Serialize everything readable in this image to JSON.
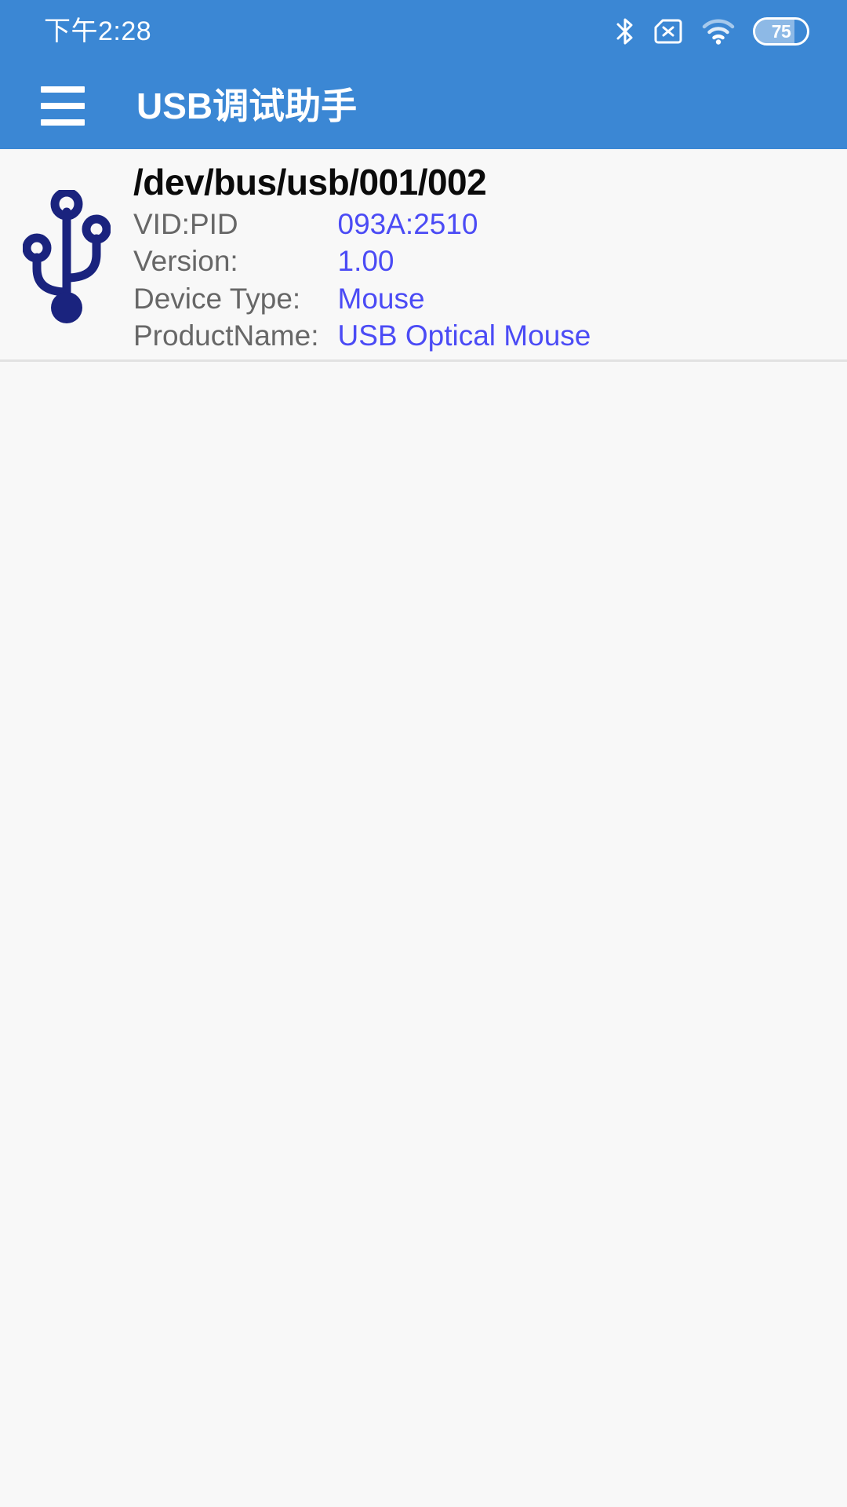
{
  "status_bar": {
    "time": "下午2:28",
    "icons": [
      {
        "name": "bluetooth-icon",
        "label": "Bluetooth"
      },
      {
        "name": "no-sim-icon",
        "label": "No SIM"
      },
      {
        "name": "wifi-icon",
        "label": "Wi-Fi"
      }
    ],
    "battery": {
      "level_text": "75",
      "level_percent": 75
    }
  },
  "app_bar": {
    "menu_icon": "hamburger-menu-icon",
    "title": "USB调试助手",
    "background_color": "#3b87d4",
    "title_color": "#ffffff"
  },
  "colors": {
    "accent": "#3b87d4",
    "page_background": "#f8f8f8",
    "key_text": "#676767",
    "value_text": "#4b4bf5",
    "path_text": "#0b0b0b",
    "usb_icon": "#1a237e",
    "divider": "#e2e2e2"
  },
  "device_list": [
    {
      "icon": "usb-trident-icon",
      "path": "/dev/bus/usb/001/002",
      "attributes": [
        {
          "key": "VID:PID",
          "value": "093A:2510"
        },
        {
          "key": "Version:",
          "value": "1.00"
        },
        {
          "key": "Device Type:",
          "value": "Mouse"
        },
        {
          "key": "ProductName:",
          "value": "USB Optical Mouse"
        }
      ]
    }
  ]
}
